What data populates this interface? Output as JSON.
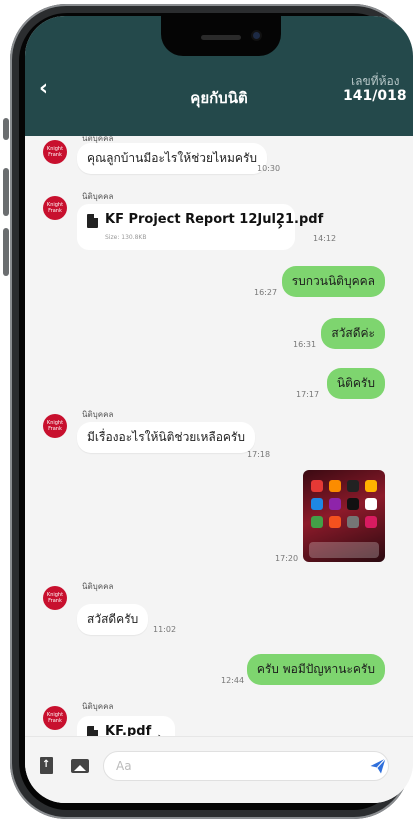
{
  "header": {
    "back_icon": "‹",
    "title": "คุยกับนิติ",
    "room_label": "เลขที่ห้อง",
    "room_number": "141/018"
  },
  "messages": [
    {
      "direction": "in",
      "sender": "นิติบุคคล",
      "text": "คุณลูกบ้านมีอะไรให้ช่วยไหมครับ",
      "time": "10:30"
    },
    {
      "direction": "in",
      "sender": "นิติบุคคล",
      "file_name": "KF Project Report 12Jul21.pdf",
      "file_size": "Size: 130.8KB",
      "time": "14:12"
    },
    {
      "direction": "out",
      "text": "รบกวนนิติบุคคล",
      "time": "16:27"
    },
    {
      "direction": "out",
      "text": "สวัสดีค่ะ",
      "time": "16:31"
    },
    {
      "direction": "out",
      "text": "นิติครับ",
      "time": "17:17"
    },
    {
      "direction": "in",
      "sender": "นิติบุคคล",
      "text": "มีเรื่องอะไรให้นิติช่วยเหลือครับ",
      "time": "17:18"
    },
    {
      "direction": "out",
      "image": "phone-screenshot-image",
      "time": "17:20"
    },
    {
      "direction": "in",
      "sender": "นิติบุคคล",
      "text": "สวัสดีครับ",
      "time": "11:02"
    },
    {
      "direction": "out",
      "text": "ครับ พอมีปัญหานะครับ",
      "time": "12:44"
    },
    {
      "direction": "in",
      "sender": "นิติบุคคล",
      "file_name": "KF.pdf"
    }
  ],
  "avatar_text": "Knight Frank",
  "input": {
    "placeholder": "Aa"
  },
  "icons": {
    "attach": "file-upload-icon",
    "image": "image-icon",
    "send": "send-icon"
  },
  "colors": {
    "header": "#24494b",
    "outgoing": "#7ed56f",
    "incoming": "#ffffff",
    "send": "#2f6fdb"
  }
}
